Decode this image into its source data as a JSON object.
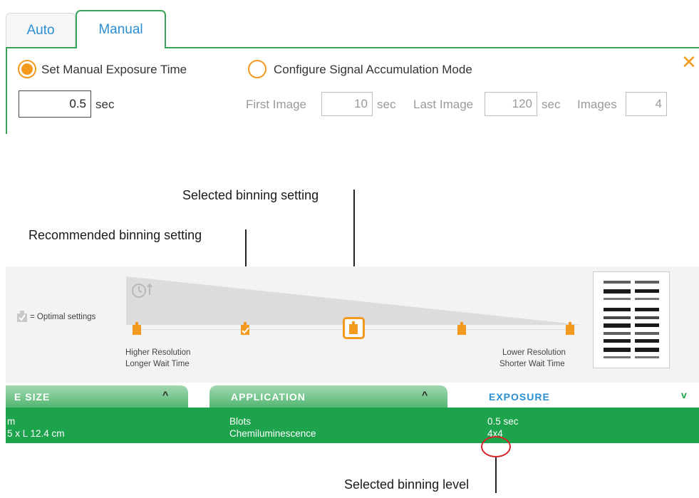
{
  "tabs": [
    {
      "label": "Auto"
    },
    {
      "label": "Manual"
    }
  ],
  "manual": {
    "option_set_exposure": "Set Manual Exposure Time",
    "option_signal_accum": "Configure Signal Accumulation Mode",
    "exposure_value": "0.5",
    "exposure_unit": "sec",
    "first_image_label": "First Image",
    "first_image_value": "10",
    "last_image_label": "Last Image",
    "last_image_value": "120",
    "images_label": "Images",
    "images_value": "4",
    "unit": "sec",
    "close_glyph": "✕"
  },
  "callouts": {
    "selected_setting": "Selected binning setting",
    "recommended_setting": "Recommended binning setting",
    "selected_level": "Selected binning level"
  },
  "binning": {
    "legend": "= Optimal settings",
    "left_line1": "Higher Resolution",
    "left_line2": "Longer Wait Time",
    "right_line1": "Lower Resolution",
    "right_line2": "Shorter Wait Time"
  },
  "bottom": {
    "size_header": "E SIZE",
    "size_line1": "m",
    "size_line2": "5 x L 12.4 cm",
    "app_header": "APPLICATION",
    "app_line1": "Blots",
    "app_line2": "Chemiluminescence",
    "exp_header": "EXPOSURE",
    "exp_line1": "0.5 sec",
    "exp_line2": "4x4",
    "chevron_up": "^",
    "chevron_down": "v"
  },
  "colors": {
    "accent_orange": "#f39a1e",
    "tab_blue": "#2b8fd3",
    "green": "#1ea34d",
    "highlight_red": "#d8232a"
  }
}
